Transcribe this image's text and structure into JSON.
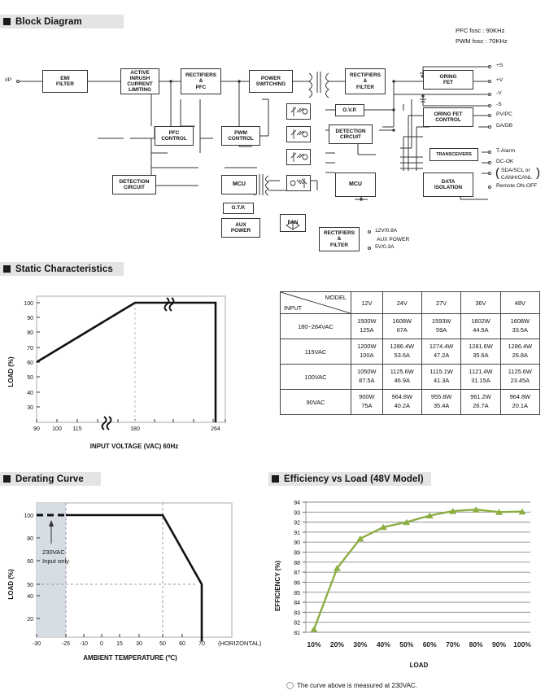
{
  "sections": {
    "block_diagram": "Block Diagram",
    "static_characteristics": "Static Characteristics",
    "derating_curve": "Derating Curve",
    "efficiency": "Efficiency vs Load (48V Model)"
  },
  "block_diagram": {
    "notes": [
      "PFC fosc : 90KHz",
      "PWM fosc : 70KHz"
    ],
    "input_label": "I/P",
    "blocks": [
      {
        "id": "emi",
        "label": "EMI\nFILTER"
      },
      {
        "id": "inrush",
        "label": "ACTIVE\nINRUSH\nCURRENT\nLIMITING"
      },
      {
        "id": "rect_pfc",
        "label": "RECTIFIERS\n&\nPFC"
      },
      {
        "id": "power_sw",
        "label": "POWER\nSWITCHING"
      },
      {
        "id": "rect_filter",
        "label": "RECTIFIERS\n&\nFILTER"
      },
      {
        "id": "oring_fet",
        "label": "ORING\nFET"
      },
      {
        "id": "pfc_control",
        "label": "PFC\nCONTROL"
      },
      {
        "id": "pwm_control",
        "label": "PWM\nCONTROL"
      },
      {
        "id": "ovp",
        "label": "O.V.P."
      },
      {
        "id": "detection_circuit_r",
        "label": "DETECTION\nCIRCUIT"
      },
      {
        "id": "oring_fet_control",
        "label": "ORING FET\nCONTROL"
      },
      {
        "id": "transceivers",
        "label": "TRANSCEIVERS"
      },
      {
        "id": "detection_circuit_l",
        "label": "DETECTION\nCIRCUIT"
      },
      {
        "id": "mcu_left",
        "label": "MCU"
      },
      {
        "id": "mcu_right",
        "label": "MCU"
      },
      {
        "id": "data_isolation",
        "label": "DATA\nISOLATION"
      },
      {
        "id": "otp",
        "label": "O.T.P."
      },
      {
        "id": "aux_power",
        "label": "AUX\nPOWER"
      },
      {
        "id": "fan",
        "label": "FAN"
      },
      {
        "id": "rect_filter_aux",
        "label": "RECTIFIERS\n&\nFILTER"
      }
    ],
    "outputs": [
      "+S",
      "+V",
      "-V",
      "-S",
      "PV/PC",
      "DA/DB",
      "T-Alarm",
      "DC-OK",
      "SDA/SCL  or",
      "CANH/CANL",
      "Remote ON-OFF"
    ],
    "aux_outputs": [
      "12V/0.8A",
      "AUX POWER",
      "5V/0.3A"
    ]
  },
  "static_chart": {
    "ylabel": "LOAD (%)",
    "xlabel": "INPUT VOLTAGE (VAC) 60Hz",
    "yticks": [
      "100",
      "90",
      "80",
      "70",
      "60",
      "50",
      "40",
      "30"
    ],
    "xticks": [
      "90",
      "100",
      "115",
      "180",
      "264"
    ]
  },
  "chart_data": [
    {
      "type": "line",
      "title": "Static Characteristics",
      "xlabel": "INPUT VOLTAGE (VAC) 60Hz",
      "ylabel": "LOAD (%)",
      "x": [
        90,
        180,
        264
      ],
      "values": [
        60,
        100,
        100
      ],
      "xlim": [
        90,
        264
      ],
      "ylim": [
        25,
        104
      ],
      "grid": false,
      "note": "Axis is broken between 115 and 180 VAC; curve drops vertically at 264 VAC."
    },
    {
      "type": "line",
      "title": "Derating Curve",
      "xlabel": "AMBIENT TEMPERATURE (℃)",
      "ylabel": "LOAD (%)",
      "x": [
        -30,
        -25,
        50,
        70
      ],
      "values": [
        100,
        100,
        100,
        50
      ],
      "xlim": [
        -30,
        75
      ],
      "ylim": [
        0,
        108
      ],
      "grid": false,
      "annotations": [
        "230VAC Input only",
        "(HORIZONTAL)"
      ],
      "shaded_region": {
        "from": -30,
        "to": -25,
        "color": "#d6dde5"
      },
      "note": "Segment from -30 to -25 is dashed (230VAC input only); curve drops vertically at 70℃."
    },
    {
      "type": "line",
      "title": "Efficiency vs Load (48V Model)",
      "xlabel": "LOAD",
      "ylabel": "EFFICIENCY (%)",
      "categories": [
        "10%",
        "20%",
        "30%",
        "40%",
        "50%",
        "60%",
        "70%",
        "80%",
        "90%",
        "100%"
      ],
      "series": [
        {
          "name": "Efficiency",
          "values": [
            81.3,
            87.4,
            90.35,
            91.5,
            92.0,
            92.65,
            93.1,
            93.25,
            93.0,
            93.05
          ]
        }
      ],
      "ylim": [
        81,
        94
      ],
      "yticks": [
        81,
        82,
        83,
        84,
        85,
        86,
        87,
        88,
        89,
        90,
        91,
        92,
        93,
        94
      ],
      "grid": true,
      "line_color": "#8cae43",
      "marker": "triangle",
      "legend": false
    }
  ],
  "derating_chart": {
    "ylabel": "LOAD (%)",
    "xlabel": "AMBIENT TEMPERATURE (℃)",
    "yticks": [
      "100",
      "80",
      "60",
      "50",
      "40",
      "20"
    ],
    "xticks": [
      "-30",
      "-25",
      "-10",
      "0",
      "15",
      "30",
      "50",
      "60",
      "70"
    ],
    "annotation": "230VAC\nInput only",
    "annotation_line1": "230VAC",
    "annotation_line2": "Input only",
    "horizontal": "(HORIZONTAL)"
  },
  "efficiency_chart": {
    "ylabel": "EFFICIENCY (%)",
    "xlabel": "LOAD"
  },
  "table": {
    "corner_model": "MODEL",
    "corner_input": "INPUT",
    "columns": [
      "12V",
      "24V",
      "27V",
      "36V",
      "48V"
    ],
    "rows": [
      {
        "input": "180~264VAC",
        "watts": [
          "1500W",
          "1608W",
          "1593W",
          "1602W",
          "1608W"
        ],
        "amps": [
          "125A",
          "67A",
          "59A",
          "44.5A",
          "33.5A"
        ]
      },
      {
        "input": "115VAC",
        "watts": [
          "1200W",
          "1286.4W",
          "1274.4W",
          "1281.6W",
          "1286.4W"
        ],
        "amps": [
          "100A",
          "53.6A",
          "47.2A",
          "35.6A",
          "26.8A"
        ]
      },
      {
        "input": "100VAC",
        "watts": [
          "1050W",
          "1125.6W",
          "1115.1W",
          "1121.4W",
          "1125.6W"
        ],
        "amps": [
          "87.5A",
          "46.9A",
          "41.3A",
          "31.15A",
          "23.45A"
        ]
      },
      {
        "input": "90VAC",
        "watts": [
          "900W",
          "964.8W",
          "955.8W",
          "961.2W",
          "964.8W"
        ],
        "amps": [
          "75A",
          "40.2A",
          "35.4A",
          "26.7A",
          "20.1A"
        ]
      }
    ]
  },
  "footnote": "The curve above is measured at 230VAC."
}
